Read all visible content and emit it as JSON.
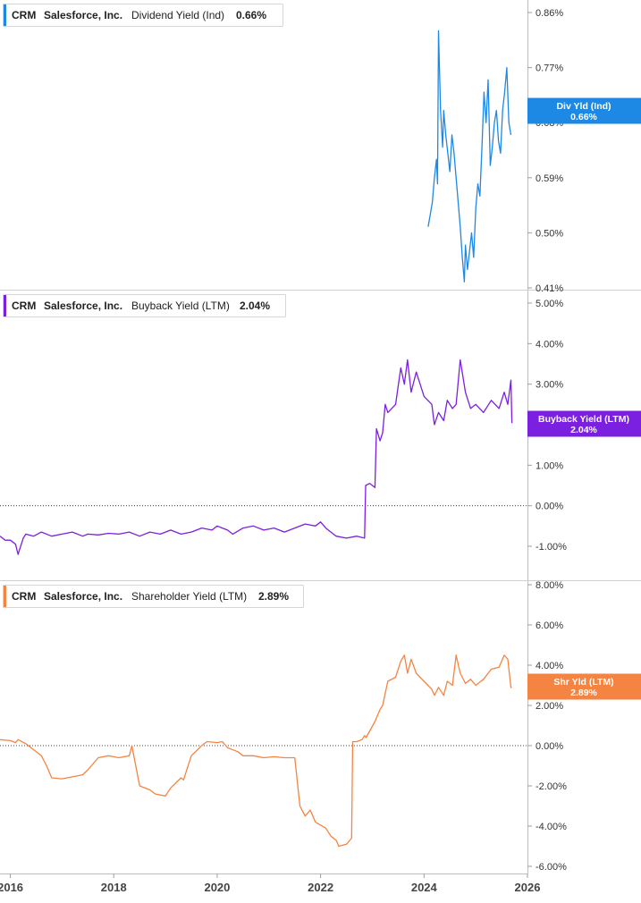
{
  "chart_data": [
    {
      "type": "line",
      "ticker": "CRM",
      "company": "Salesforce, Inc.",
      "metric": "Dividend Yield (Ind)",
      "current_value": "0.66%",
      "tag_label": "Div Yld (Ind)",
      "tag_value": "0.66%",
      "color": "#1e88e5",
      "ylim": [
        0.41,
        0.88
      ],
      "yticks": [
        0.86,
        0.77,
        0.68,
        0.59,
        0.5,
        0.41
      ],
      "ytick_labels": [
        "0.86%",
        "0.77%",
        "0.68%",
        "0.59%",
        "0.50%",
        "0.41%"
      ],
      "zero_line": false,
      "series": [
        {
          "x": [
            2024.08,
            2024.12,
            2024.16,
            2024.2,
            2024.24,
            2024.26,
            2024.28,
            2024.32,
            2024.36,
            2024.38,
            2024.42,
            2024.46,
            2024.5,
            2024.54,
            2024.58,
            2024.62,
            2024.66,
            2024.7,
            2024.74,
            2024.78,
            2024.8,
            2024.84,
            2024.88,
            2024.92,
            2024.96,
            2025.0,
            2025.04,
            2025.08,
            2025.12,
            2025.16,
            2025.2,
            2025.24,
            2025.28,
            2025.32,
            2025.36,
            2025.4,
            2025.44,
            2025.48,
            2025.52,
            2025.56,
            2025.6,
            2025.64,
            2025.68
          ],
          "y": [
            0.51,
            0.53,
            0.55,
            0.59,
            0.62,
            0.58,
            0.83,
            0.7,
            0.64,
            0.7,
            0.66,
            0.63,
            0.6,
            0.66,
            0.63,
            0.59,
            0.55,
            0.51,
            0.46,
            0.42,
            0.48,
            0.44,
            0.47,
            0.5,
            0.46,
            0.54,
            0.58,
            0.56,
            0.64,
            0.73,
            0.68,
            0.75,
            0.61,
            0.64,
            0.68,
            0.7,
            0.65,
            0.63,
            0.7,
            0.73,
            0.77,
            0.68,
            0.66
          ]
        }
      ]
    },
    {
      "type": "line",
      "ticker": "CRM",
      "company": "Salesforce, Inc.",
      "metric": "Buyback Yield (LTM)",
      "current_value": "2.04%",
      "tag_label": "Buyback Yield (LTM)",
      "tag_value": "2.04%",
      "color": "#7b1fe0",
      "ylim": [
        -1.35,
        5.1
      ],
      "yticks": [
        5,
        4,
        3,
        2,
        1,
        0,
        -1
      ],
      "ytick_labels": [
        "5.00%",
        "4.00%",
        "3.00%",
        "2.00%",
        "1.00%",
        "0.00%",
        "-1.00%"
      ],
      "zero_line": true,
      "series": [
        {
          "x": [
            2015.8,
            2015.9,
            2016.0,
            2016.1,
            2016.15,
            2016.25,
            2016.3,
            2016.45,
            2016.6,
            2016.8,
            2017.0,
            2017.2,
            2017.4,
            2017.5,
            2017.7,
            2017.9,
            2018.1,
            2018.3,
            2018.5,
            2018.7,
            2018.9,
            2019.1,
            2019.3,
            2019.5,
            2019.7,
            2019.9,
            2020.0,
            2020.1,
            2020.2,
            2020.3,
            2020.5,
            2020.7,
            2020.9,
            2021.1,
            2021.3,
            2021.5,
            2021.7,
            2021.9,
            2022.0,
            2022.1,
            2022.3,
            2022.5,
            2022.7,
            2022.85,
            2022.87,
            2022.95,
            2023.05,
            2023.08,
            2023.15,
            2023.2,
            2023.25,
            2023.3,
            2023.45,
            2023.55,
            2023.62,
            2023.68,
            2023.75,
            2023.85,
            2024.0,
            2024.15,
            2024.2,
            2024.28,
            2024.38,
            2024.45,
            2024.55,
            2024.62,
            2024.7,
            2024.8,
            2024.9,
            2025.0,
            2025.15,
            2025.3,
            2025.45,
            2025.55,
            2025.62,
            2025.68,
            2025.7
          ],
          "y": [
            -0.75,
            -0.85,
            -0.85,
            -0.95,
            -1.2,
            -0.8,
            -0.7,
            -0.75,
            -0.65,
            -0.75,
            -0.7,
            -0.65,
            -0.75,
            -0.7,
            -0.72,
            -0.68,
            -0.7,
            -0.65,
            -0.75,
            -0.65,
            -0.7,
            -0.6,
            -0.7,
            -0.65,
            -0.55,
            -0.6,
            -0.5,
            -0.55,
            -0.6,
            -0.7,
            -0.55,
            -0.5,
            -0.6,
            -0.55,
            -0.65,
            -0.55,
            -0.45,
            -0.5,
            -0.4,
            -0.55,
            -0.75,
            -0.8,
            -0.75,
            -0.8,
            0.5,
            0.55,
            0.45,
            1.9,
            1.6,
            1.8,
            2.5,
            2.3,
            2.5,
            3.4,
            3.0,
            3.6,
            2.8,
            3.3,
            2.7,
            2.5,
            2.0,
            2.3,
            2.1,
            2.6,
            2.4,
            2.5,
            3.6,
            2.8,
            2.4,
            2.5,
            2.3,
            2.6,
            2.4,
            2.8,
            2.5,
            3.1,
            2.04
          ]
        }
      ]
    },
    {
      "type": "line",
      "ticker": "CRM",
      "company": "Salesforce, Inc.",
      "metric": "Shareholder Yield (LTM)",
      "current_value": "2.89%",
      "tag_label": "Shr Yld (LTM)",
      "tag_value": "2.89%",
      "color": "#f58442",
      "ylim": [
        -6.2,
        8.2
      ],
      "yticks": [
        8,
        6,
        4,
        2,
        0,
        -2,
        -4,
        -6
      ],
      "ytick_labels": [
        "8.00%",
        "6.00%",
        "4.00%",
        "2.00%",
        "0.00%",
        "-2.00%",
        "-4.00%",
        "-6.00%"
      ],
      "zero_line": true,
      "series": [
        {
          "x": [
            2015.8,
            2016.0,
            2016.1,
            2016.15,
            2016.3,
            2016.45,
            2016.6,
            2016.7,
            2016.8,
            2017.0,
            2017.2,
            2017.4,
            2017.5,
            2017.7,
            2017.9,
            2018.1,
            2018.3,
            2018.35,
            2018.5,
            2018.7,
            2018.8,
            2019.0,
            2019.1,
            2019.3,
            2019.35,
            2019.5,
            2019.7,
            2019.8,
            2020.0,
            2020.1,
            2020.2,
            2020.4,
            2020.5,
            2020.7,
            2020.9,
            2021.1,
            2021.3,
            2021.5,
            2021.6,
            2021.7,
            2021.8,
            2021.9,
            2022.1,
            2022.2,
            2022.3,
            2022.35,
            2022.5,
            2022.6,
            2022.62,
            2022.7,
            2022.8,
            2022.85,
            2022.88,
            2023.05,
            2023.15,
            2023.2,
            2023.3,
            2023.45,
            2023.55,
            2023.62,
            2023.68,
            2023.75,
            2023.85,
            2024.0,
            2024.15,
            2024.2,
            2024.28,
            2024.38,
            2024.45,
            2024.55,
            2024.62,
            2024.7,
            2024.8,
            2024.9,
            2025.0,
            2025.15,
            2025.3,
            2025.45,
            2025.55,
            2025.62,
            2025.68,
            2025.7
          ],
          "y": [
            0.3,
            0.25,
            0.15,
            0.3,
            0.1,
            -0.2,
            -0.5,
            -1.0,
            -1.6,
            -1.65,
            -1.55,
            -1.45,
            -1.2,
            -0.6,
            -0.5,
            -0.6,
            -0.5,
            0.0,
            -2.0,
            -2.2,
            -2.4,
            -2.5,
            -2.1,
            -1.6,
            -1.7,
            -0.5,
            0.0,
            0.2,
            0.15,
            0.2,
            -0.1,
            -0.3,
            -0.5,
            -0.5,
            -0.6,
            -0.55,
            -0.6,
            -0.6,
            -3.0,
            -3.5,
            -3.2,
            -3.8,
            -4.1,
            -4.5,
            -4.7,
            -5.0,
            -4.9,
            -4.6,
            0.2,
            0.2,
            0.3,
            0.5,
            0.4,
            1.2,
            1.8,
            2.0,
            3.2,
            3.4,
            4.2,
            4.5,
            3.6,
            4.3,
            3.6,
            3.2,
            2.8,
            2.5,
            2.9,
            2.5,
            3.2,
            3.0,
            4.5,
            3.6,
            3.1,
            3.3,
            3.0,
            3.3,
            3.8,
            3.9,
            4.5,
            4.3,
            2.89,
            2.89
          ]
        }
      ]
    }
  ],
  "x_axis": {
    "range": [
      2015.8,
      2026.0
    ],
    "ticks": [
      2016,
      2018,
      2020,
      2022,
      2024,
      2026
    ],
    "tick_labels": [
      "2016",
      "2018",
      "2020",
      "2022",
      "2024",
      "2026"
    ]
  }
}
